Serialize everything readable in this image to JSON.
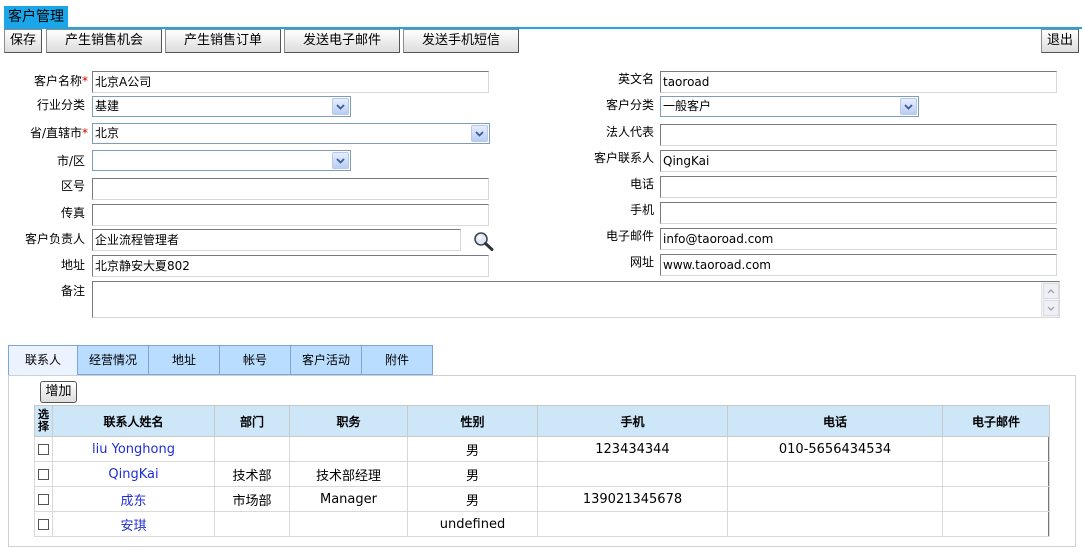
{
  "window": {
    "title": "客户管理"
  },
  "toolbar": {
    "save": "保存",
    "create_opportunity": "产生销售机会",
    "create_order": "产生销售订单",
    "send_email": "发送电子邮件",
    "send_sms": "发送手机短信",
    "exit": "退出"
  },
  "form": {
    "customer_name": {
      "label": "客户名称",
      "value": "北京A公司",
      "required": "*"
    },
    "industry": {
      "label": "行业分类",
      "value": "基建"
    },
    "province": {
      "label": "省/直辖市",
      "value": "北京",
      "required": "*"
    },
    "city": {
      "label": "市/区",
      "value": ""
    },
    "area_code": {
      "label": "区号",
      "value": ""
    },
    "fax": {
      "label": "传真",
      "value": ""
    },
    "owner": {
      "label": "客户负责人",
      "value": "企业流程管理者"
    },
    "address": {
      "label": "地址",
      "value": "北京静安大夏802"
    },
    "remark": {
      "label": "备注",
      "value": ""
    },
    "english_name": {
      "label": "英文名",
      "value": "taoroad"
    },
    "customer_type": {
      "label": "客户分类",
      "value": "一般客户"
    },
    "legal_rep": {
      "label": "法人代表",
      "value": ""
    },
    "contact": {
      "label": "客户联系人",
      "value": "QingKai"
    },
    "phone": {
      "label": "电话",
      "value": ""
    },
    "mobile": {
      "label": "手机",
      "value": ""
    },
    "email": {
      "label": "电子邮件",
      "value": "info@taoroad.com"
    },
    "website": {
      "label": "网址",
      "value": "www.taoroad.com"
    }
  },
  "tabs": [
    "联系人",
    "经营情况",
    "地址",
    "帐号",
    "客户活动",
    "附件"
  ],
  "contacts": {
    "add_label": "增加",
    "headers": [
      "选择",
      "联系人姓名",
      "部门",
      "职务",
      "性别",
      "手机",
      "电话",
      "电子邮件"
    ],
    "rows": [
      {
        "name": "liu Yonghong",
        "dept": "",
        "title": "",
        "gender": "男",
        "mobile": "123434344",
        "phone": "010-5656434534",
        "email": ""
      },
      {
        "name": "QingKai",
        "dept": "技术部",
        "title": "技术部经理",
        "gender": "男",
        "mobile": "",
        "phone": "",
        "email": ""
      },
      {
        "name": "成东",
        "dept": "市场部",
        "title": "Manager",
        "gender": "男",
        "mobile": "139021345678",
        "phone": "",
        "email": ""
      },
      {
        "name": "安琪",
        "dept": "",
        "title": "",
        "gender": "undefined",
        "mobile": "",
        "phone": "",
        "email": ""
      }
    ]
  },
  "icons": {
    "search": "magnifier-icon",
    "dropdown": "chevron-down-icon"
  }
}
